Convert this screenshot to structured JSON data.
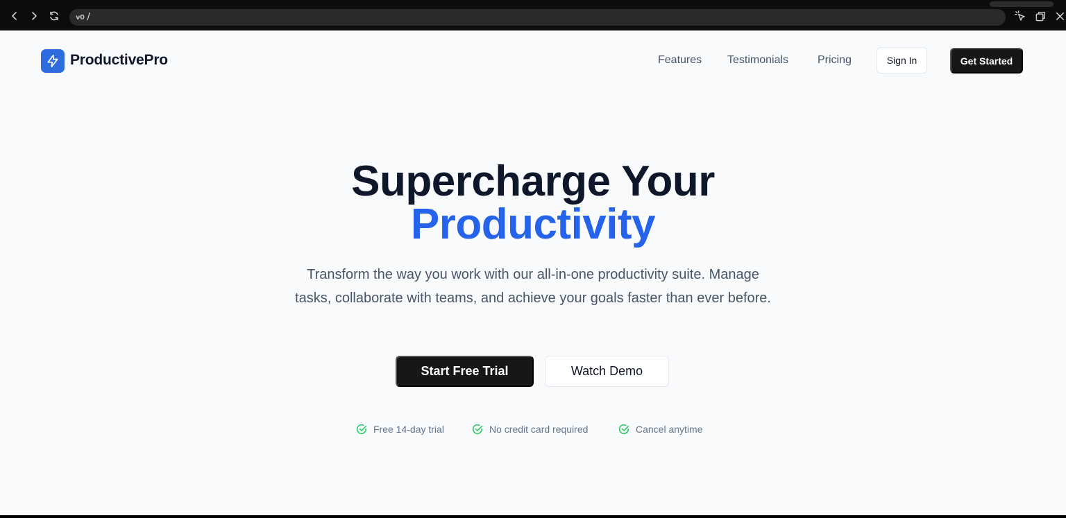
{
  "browser": {
    "url_prefix": "v0",
    "url": "/"
  },
  "header": {
    "brand": "ProductivePro",
    "nav": [
      "Features",
      "Testimonials",
      "Pricing"
    ],
    "sign_in": "Sign In",
    "get_started": "Get Started"
  },
  "hero": {
    "title_line1": "Supercharge Your",
    "title_line2": "Productivity",
    "subtitle": "Transform the way you work with our all-in-one productivity suite. Manage tasks, collaborate with teams, and achieve your goals faster than ever before.",
    "primary_cta": "Start Free Trial",
    "secondary_cta": "Watch Demo",
    "perks": [
      "Free 14-day trial",
      "No credit card required",
      "Cancel anytime"
    ]
  },
  "colors": {
    "brand": "#2563eb",
    "check": "#22c55e",
    "dark": "#171717"
  }
}
